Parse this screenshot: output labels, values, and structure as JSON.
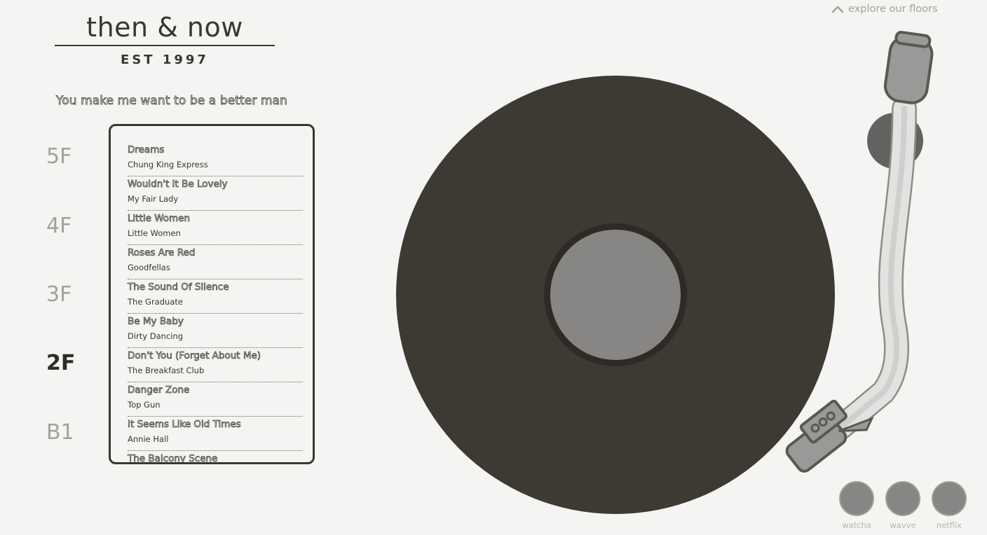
{
  "brand": {
    "title": "then & now",
    "established": "EST 1997"
  },
  "now_playing": "You make me want to be a better man",
  "nav": {
    "explore_label": "explore our floors"
  },
  "floors": [
    {
      "label": "5F",
      "active": false
    },
    {
      "label": "4F",
      "active": false
    },
    {
      "label": "3F",
      "active": false
    },
    {
      "label": "2F",
      "active": true
    },
    {
      "label": "B1",
      "active": false
    }
  ],
  "playlist": [
    {
      "title": "Dreams",
      "film": "Chung King Express"
    },
    {
      "title": "Wouldn't It Be Lovely",
      "film": "My Fair Lady"
    },
    {
      "title": "Little Women",
      "film": "Little Women"
    },
    {
      "title": "Roses Are Red",
      "film": "Goodfellas"
    },
    {
      "title": "The Sound Of Silence",
      "film": "The Graduate"
    },
    {
      "title": "Be My Baby",
      "film": "Dirty Dancing"
    },
    {
      "title": "Don't You (Forget About Me)",
      "film": "The Breakfast Club"
    },
    {
      "title": "Danger Zone",
      "film": "Top Gun"
    },
    {
      "title": "It Seems Like Old Times",
      "film": "Annie Hall"
    },
    {
      "title": "The Balcony Scene",
      "film": ""
    }
  ],
  "services": [
    {
      "label": "watcha"
    },
    {
      "label": "wavve"
    },
    {
      "label": "netflix"
    }
  ],
  "icons": {
    "explore": "chevron-up-icon",
    "record": "vinyl-record-icon",
    "tonearm": "tonearm-icon"
  },
  "colors": {
    "background": "#f4f4f2",
    "ink": "#3a3631",
    "record": "#3d3a34",
    "label": "#878684",
    "muted": "#a3a19d"
  }
}
